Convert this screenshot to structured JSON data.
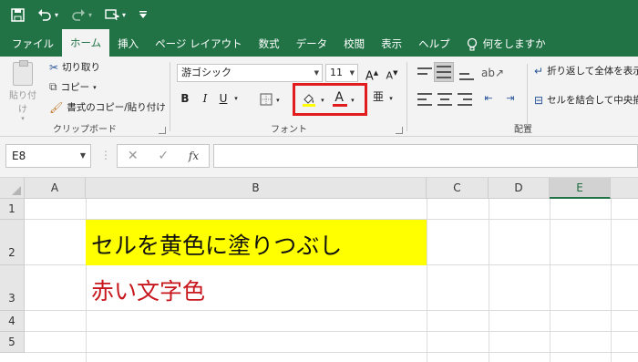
{
  "quick_access": {
    "save_icon": "save-icon",
    "undo_icon": "undo-icon",
    "redo_icon": "redo-icon",
    "touch_mode_icon": "touch-mode-icon",
    "customize_icon": "customize-icon"
  },
  "tabs": [
    {
      "label": "ファイル"
    },
    {
      "label": "ホーム"
    },
    {
      "label": "挿入"
    },
    {
      "label": "ページ レイアウト"
    },
    {
      "label": "数式"
    },
    {
      "label": "データ"
    },
    {
      "label": "校閲"
    },
    {
      "label": "表示"
    },
    {
      "label": "ヘルプ"
    },
    {
      "label": "何をしますか"
    }
  ],
  "clipboard": {
    "paste_label": "貼り付け",
    "cut_label": "切り取り",
    "copy_label": "コピー",
    "format_painter_label": "書式のコピー/貼り付け",
    "group_label": "クリップボード"
  },
  "font": {
    "name": "游ゴシック",
    "size": "11",
    "grow_label": "A",
    "shrink_label": "A",
    "bold_label": "B",
    "italic_label": "I",
    "underline_label": "U",
    "font_color_label": "A",
    "phonetic_label": "亜",
    "group_label": "フォント",
    "fill_color": "#ffff00",
    "font_color": "#e21c1c"
  },
  "alignment": {
    "wrap_text_label": "折り返して全体を表示",
    "merge_center_label": "セルを結合して中央揃",
    "group_label": "配置"
  },
  "formula_bar": {
    "name_box": "E8",
    "cancel_label": "✕",
    "enter_label": "✓",
    "fx_label": "fx",
    "formula": ""
  },
  "sheet": {
    "columns": [
      "A",
      "B",
      "C",
      "D",
      "E"
    ],
    "rows": [
      "1",
      "2",
      "3",
      "4",
      "5"
    ],
    "selected_column": "E",
    "cell_b2": "セルを黄色に塗りつぶし",
    "cell_b3": "赤い文字色",
    "cell_b2_fill": "#ffff00",
    "cell_b3_color": "#c8161d"
  },
  "colors": {
    "accent": "#217346",
    "highlight_box": "#e21c1c"
  }
}
